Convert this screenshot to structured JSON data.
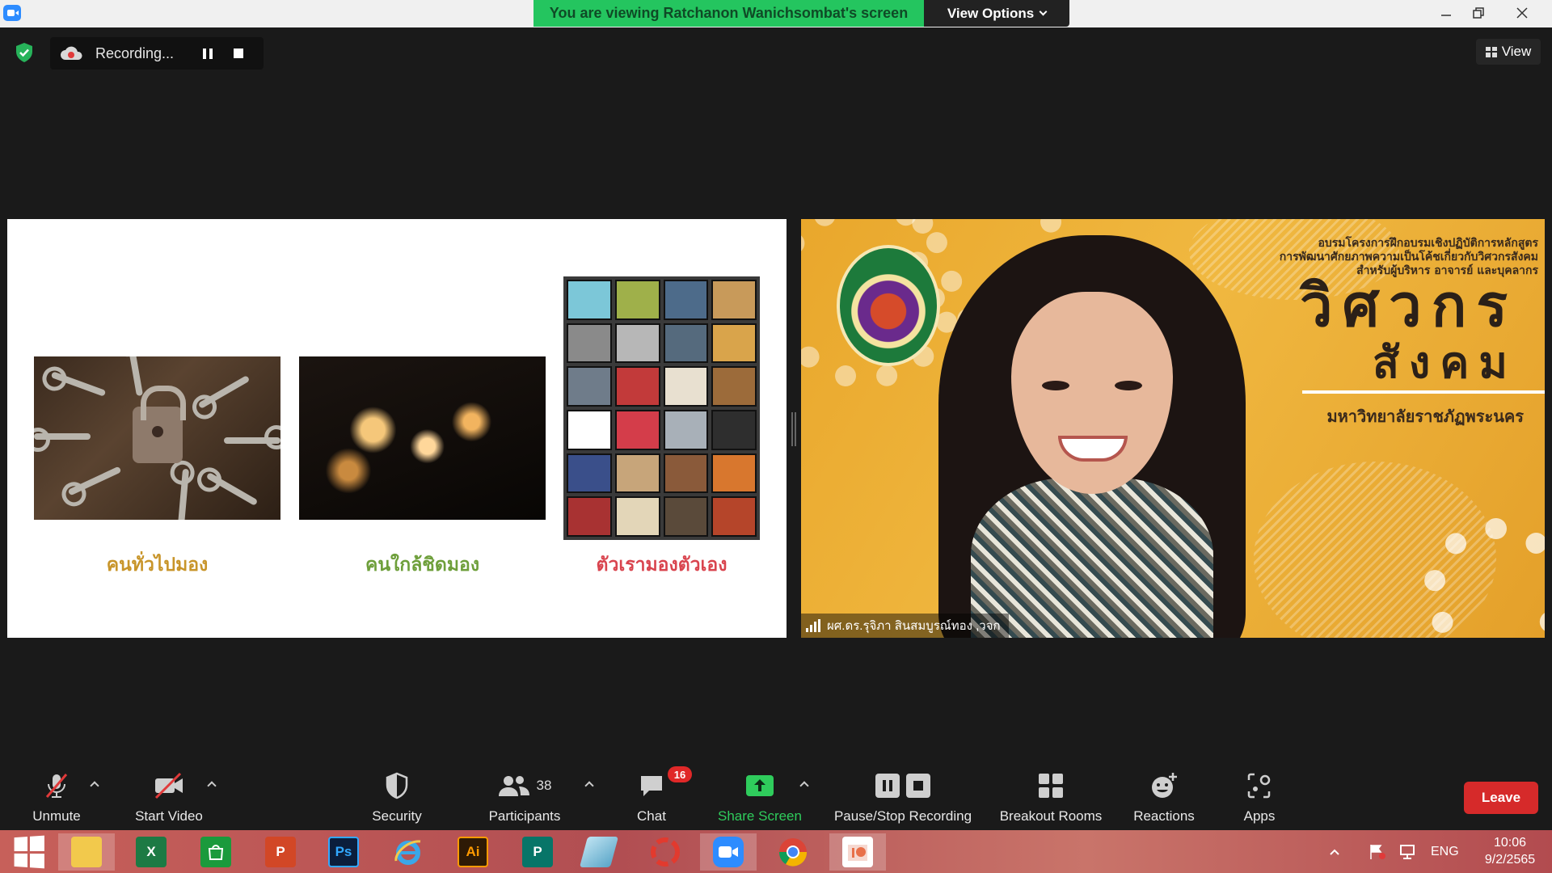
{
  "titlebar": {
    "share_banner": "You are viewing Ratchanon Wanichsombat's screen",
    "view_options": "View Options"
  },
  "recording": {
    "label": "Recording..."
  },
  "view_button": {
    "label": "View"
  },
  "shared_slide": {
    "captions": [
      "คนทั่วไปมอง",
      "คนใกล้ชิดมอง",
      "ตัวเรามองตัวเอง"
    ],
    "caption_colors": [
      "#c8952a",
      "#6e9f3b",
      "#d9444e"
    ]
  },
  "video": {
    "participant_name": "ผศ.ดร.รุจิภา สินสมบูรณ์ทอง ,วจก",
    "background_text": {
      "line1": "อบรมโครงการฝึกอบรมเชิงปฏิบัติการหลักสูตร",
      "line2": "การพัฒนาศักยภาพความเป็นโค้ชเกี่ยวกับวิศวกรสังคม",
      "line3": "สำหรับผู้บริหาร อาจารย์ และบุคลากร",
      "title1": "วิศวกร",
      "title2": "สังคม",
      "university": "มหาวิทยาลัยราชภัฏพระนคร"
    }
  },
  "toolbar": {
    "unmute": "Unmute",
    "start_video": "Start Video",
    "security": "Security",
    "participants": "Participants",
    "participants_count": "38",
    "chat": "Chat",
    "chat_badge": "16",
    "share_screen": "Share Screen",
    "pause_stop_recording": "Pause/Stop Recording",
    "breakout_rooms": "Breakout Rooms",
    "reactions": "Reactions",
    "apps": "Apps",
    "leave": "Leave"
  },
  "taskbar": {
    "apps": [
      "start",
      "file-explorer",
      "excel",
      "store",
      "powerpoint",
      "photoshop",
      "internet-explorer",
      "illustrator",
      "publisher",
      "tool",
      "fotoscape",
      "zoom",
      "chrome",
      "paint"
    ],
    "labels": {
      "ps": "Ps",
      "ai": "Ai",
      "p": "P",
      "x": "X"
    },
    "language": "ENG",
    "time": "10:06",
    "date": "9/2/2565"
  },
  "colors": {
    "accent_green": "#24c55f",
    "leave_red": "#d62a2a",
    "badge_red": "#e02828",
    "zoom_blue": "#2d8cff"
  }
}
